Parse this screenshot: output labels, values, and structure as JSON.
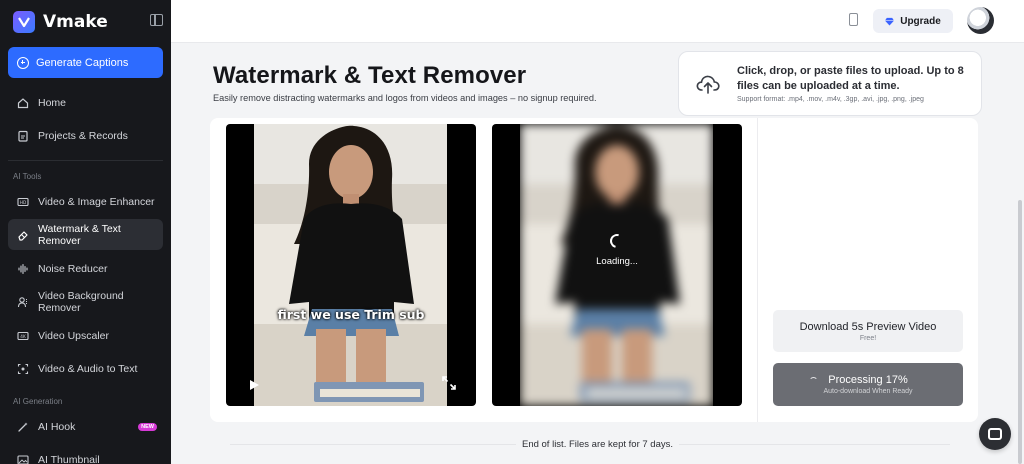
{
  "app": {
    "name": "Vmake"
  },
  "sidebar": {
    "primary_action": "Generate Captions",
    "top_items": [
      {
        "label": "Home",
        "icon": "home-icon"
      },
      {
        "label": "Projects & Records",
        "icon": "clipboard-icon"
      }
    ],
    "sections": [
      {
        "label": "AI Tools",
        "items": [
          {
            "label": "Video & Image Enhancer",
            "icon": "hd-icon"
          },
          {
            "label": "Watermark & Text Remover",
            "icon": "eraser-icon",
            "active": true
          },
          {
            "label": "Noise Reducer",
            "icon": "waveform-icon"
          },
          {
            "label": "Video Background Remover",
            "icon": "person-cutout-icon"
          },
          {
            "label": "Video Upscaler",
            "icon": "4k-icon"
          },
          {
            "label": "Video & Audio to Text",
            "icon": "transcribe-icon"
          }
        ]
      },
      {
        "label": "AI Generation",
        "items": [
          {
            "label": "AI Hook",
            "icon": "magic-wand-icon",
            "badge": "NEW"
          },
          {
            "label": "AI Thumbnail",
            "icon": "thumbnail-icon"
          }
        ]
      }
    ]
  },
  "topbar": {
    "upgrade_label": "Upgrade"
  },
  "header": {
    "title": "Watermark & Text Remover",
    "subtitle": "Easily remove distracting watermarks and logos from videos and images – no signup required."
  },
  "upload": {
    "main_text": "Click, drop, or paste files to upload. Up to 8 files can be uploaded at a time.",
    "formats": "Support format: .mp4, .mov, .m4v, .3gp, .avi, .jpg, .png, .jpeg"
  },
  "preview": {
    "original_caption": "first we use Trim sub",
    "loading_label": "Loading..."
  },
  "actions": {
    "download": {
      "label": "Download 5s Preview Video",
      "sub": "Free!"
    },
    "processing": {
      "label": "Processing 17%",
      "sub": "Auto-download When Ready",
      "progress": 0.17
    }
  },
  "footer": {
    "end_text": "End of list. Files are kept for 7 days."
  },
  "colors": {
    "accent": "#2d6bff",
    "sidebar_bg": "#17181c",
    "new_badge": "#d63ad6"
  }
}
